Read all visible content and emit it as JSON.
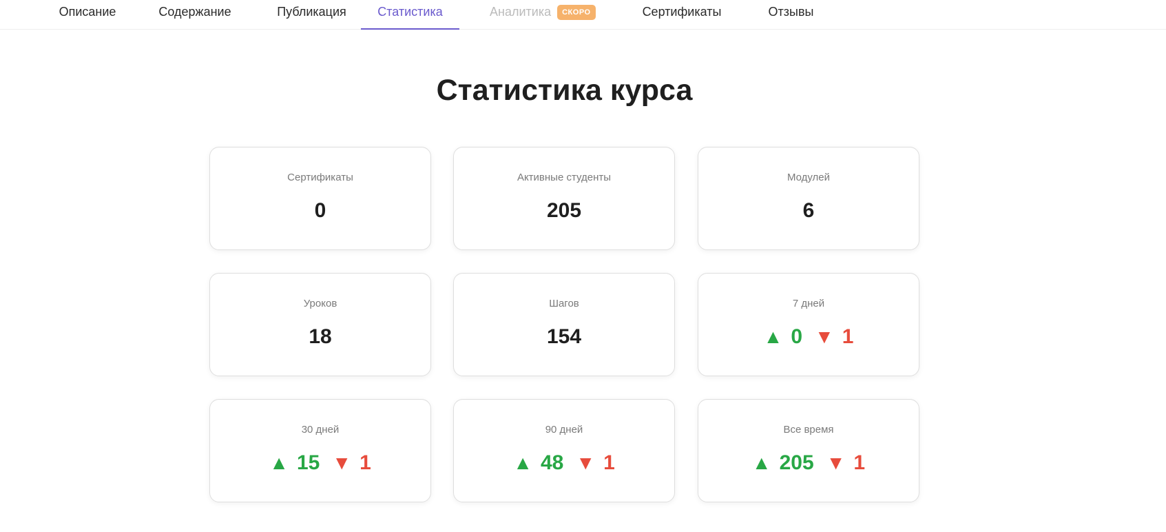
{
  "tabs": [
    {
      "label": "Описание"
    },
    {
      "label": "Содержание"
    },
    {
      "label": "Публикация"
    },
    {
      "label": "Статистика"
    },
    {
      "label": "Аналитика",
      "badge": "СКОРО"
    },
    {
      "label": "Сертификаты"
    },
    {
      "label": "Отзывы"
    }
  ],
  "active_tab": "Статистика",
  "page_title": "Статистика курса",
  "stats": [
    {
      "label": "Сертификаты",
      "value": "0"
    },
    {
      "label": "Активные студенты",
      "value": "205"
    },
    {
      "label": "Модулей",
      "value": "6"
    },
    {
      "label": "Уроков",
      "value": "18"
    },
    {
      "label": "Шагов",
      "value": "154"
    }
  ],
  "trends": [
    {
      "label": "7 дней",
      "up": "0",
      "down": "1"
    },
    {
      "label": "30 дней",
      "up": "15",
      "down": "1"
    },
    {
      "label": "90 дней",
      "up": "48",
      "down": "1"
    },
    {
      "label": "Все время",
      "up": "205",
      "down": "1"
    }
  ],
  "icons": {
    "up": "▲",
    "down": "▼"
  },
  "colors": {
    "accent": "#6a5acd",
    "up": "#28a745",
    "down": "#e74c3c",
    "badge": "#f6b26b"
  }
}
